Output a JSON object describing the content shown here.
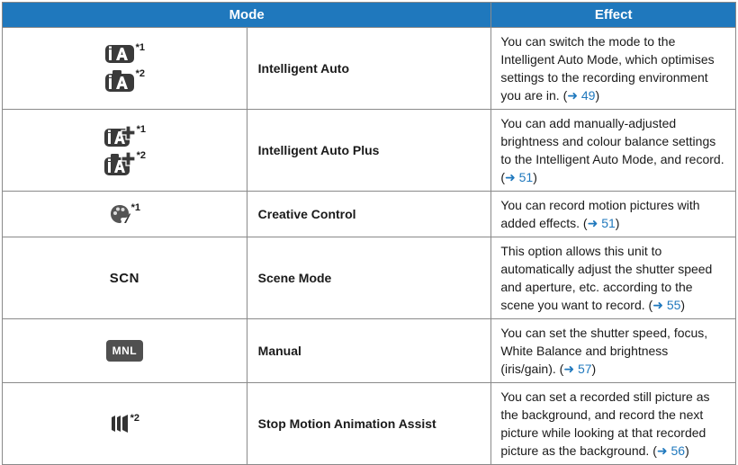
{
  "table": {
    "headers": {
      "mode": "Mode",
      "effect": "Effect"
    },
    "rows": [
      {
        "icon": "intelligent-auto-icon",
        "footnotes": [
          "*1",
          "*2"
        ],
        "name": "Intelligent Auto",
        "effect": "You can switch the mode to the Intelligent Auto Mode, which optimises settings to the recording environment you are in. (",
        "arrow": "➜",
        "page": "49",
        "close": ")"
      },
      {
        "icon": "intelligent-auto-plus-icon",
        "footnotes": [
          "*1",
          "*2"
        ],
        "name": "Intelligent Auto Plus",
        "effect": "You can add manually-adjusted brightness and colour balance settings to the Intelligent Auto Mode, and record. (",
        "arrow": "➜",
        "page": "51",
        "close": ")"
      },
      {
        "icon": "creative-control-icon",
        "footnotes": [
          "*1"
        ],
        "name": "Creative Control",
        "effect": "You can record motion pictures with added effects. (",
        "arrow": "➜",
        "page": "51",
        "close": ")"
      },
      {
        "icon_text": "SCN",
        "name": "Scene Mode",
        "effect": "This option allows this unit to automatically adjust the shutter speed and aperture, etc. according to the scene you want to record. (",
        "arrow": "➜",
        "page": "55",
        "close": ")"
      },
      {
        "icon_text": "MNL",
        "name": "Manual",
        "effect": "You can set the shutter speed, focus, White Balance and brightness (iris/gain). (",
        "arrow": "➜",
        "page": "57",
        "close": ")"
      },
      {
        "icon": "stop-motion-icon",
        "footnotes": [
          "*2"
        ],
        "name": "Stop Motion Animation Assist",
        "effect": "You can set a recorded still picture as the background, and record the next picture while looking at that recorded picture as the background. (",
        "arrow": "➜",
        "page": "56",
        "close": ")"
      }
    ]
  }
}
